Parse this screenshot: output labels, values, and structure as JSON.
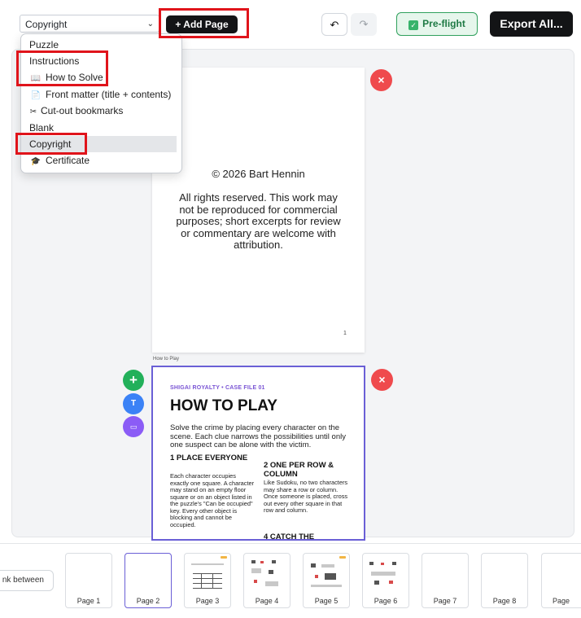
{
  "toolbar": {
    "page_type_select": "Copyright",
    "add_page_label": "+ Add Page",
    "undo_icon": "↶",
    "redo_icon": "↷",
    "preflight_label": "Pre-flight",
    "export_label": "Export All..."
  },
  "dropdown": {
    "groups": {
      "puzzle": "Puzzle",
      "instructions": "Instructions",
      "blank": "Blank"
    },
    "items": {
      "how_to_solve": "How to Solve",
      "front_matter": "Front matter (title + contents)",
      "cutout_bookmarks": "Cut-out bookmarks",
      "copyright": "Copyright",
      "certificate": "Certificate"
    },
    "selected": "Copyright"
  },
  "page1": {
    "copyright_line": "© 2026 Bart Hennin",
    "rights_text": "All rights reserved. This work may not be reproduced for commercial purposes; short excerpts for review or commentary are welcome with attribution.",
    "page_number": "1"
  },
  "page2": {
    "label": "How to Play",
    "kicker": "SHIGAI ROYALTY  •  CASE FILE 01",
    "title": "HOW TO PLAY",
    "intro": "Solve the crime by placing every character on the scene. Each clue narrows the possibilities until only one suspect can be alone with the victim.",
    "sections": [
      {
        "heading": "1  PLACE EVERYONE",
        "text": "Each character occupies exactly one square. A character may stand on an empty floor square or on an object listed in the puzzle's \"Can be occupied\" key. Every other object is blocking and cannot be occupied."
      },
      {
        "heading": "2  ONE PER ROW & COLUMN",
        "text": "Like Sudoku, no two characters may share a row or column. Once someone is placed, cross out every other square in that row and column."
      },
      {
        "heading": "4  CATCH THE",
        "text": ""
      }
    ]
  },
  "side_buttons": {
    "add": "+",
    "text": "T",
    "image": "▭"
  },
  "delete_icon": "×",
  "strip": {
    "blank_between": "nk between",
    "thumbs": [
      "Page 1",
      "Page 2",
      "Page 3",
      "Page 4",
      "Page 5",
      "Page 6",
      "Page 7",
      "Page 8",
      "Page"
    ]
  },
  "colors": {
    "accent_purple": "#6a5fd6",
    "delete_red": "#ef4a4d",
    "preflight_green": "#2fa05c",
    "highlight_red": "#e0141b"
  }
}
